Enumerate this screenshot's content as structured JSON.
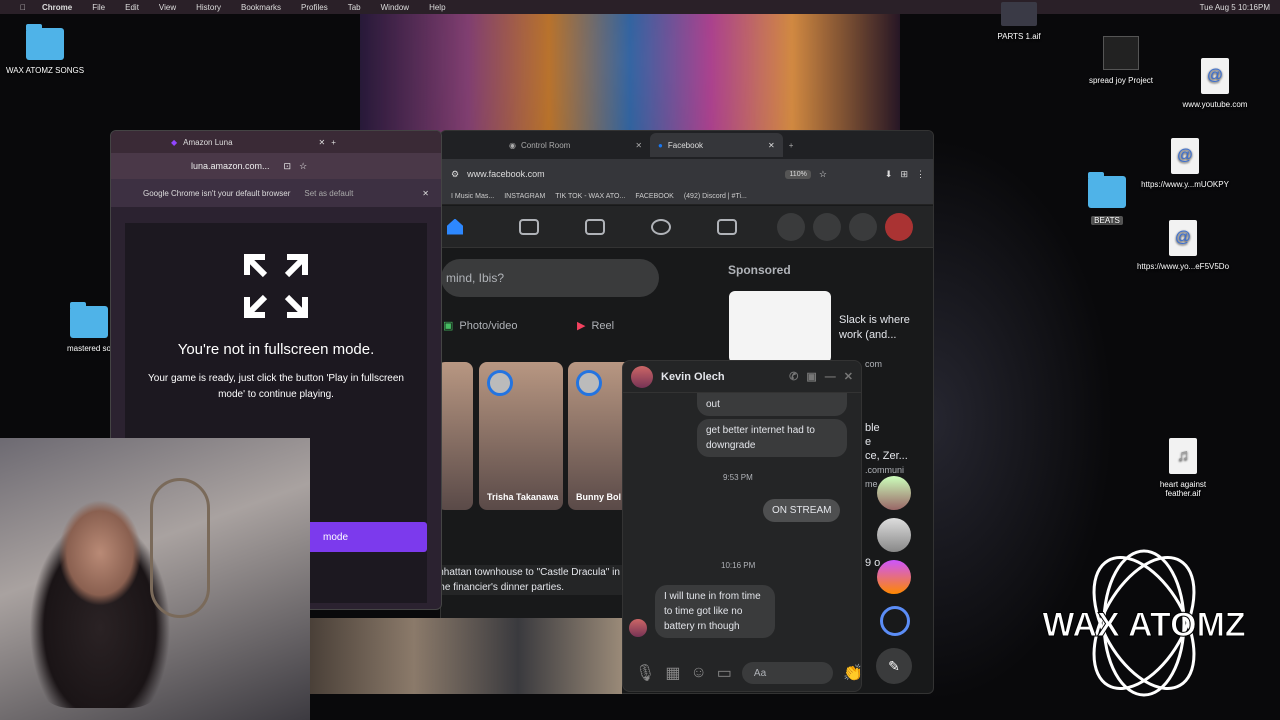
{
  "menubar": {
    "app": "Chrome",
    "items": [
      "File",
      "Edit",
      "View",
      "History",
      "Bookmarks",
      "Profiles",
      "Tab",
      "Window",
      "Help"
    ],
    "clock": "Tue Aug 5  10:16PM"
  },
  "desktop_icons": [
    {
      "label": "WAX ATOMZ SONGS",
      "type": "folder"
    },
    {
      "label": "mastered so",
      "type": "folder"
    },
    {
      "label": "PARTS 1.aif",
      "type": "file"
    },
    {
      "label": "spread joy Project",
      "type": "file"
    },
    {
      "label": "www.youtube.com",
      "type": "webloc"
    },
    {
      "label": "https://www.y...mUOKPY",
      "type": "webloc"
    },
    {
      "label": "BEATS",
      "type": "folder"
    },
    {
      "label": "https://www.yo...eF5V5Do",
      "type": "webloc"
    },
    {
      "label": "heart against feather.aif",
      "type": "audio"
    }
  ],
  "luna": {
    "tab_title": "Amazon Luna",
    "url": "luna.amazon.com...",
    "info_text": "Google Chrome isn't your default browser",
    "set_default": "Set as default",
    "title": "You're not in fullscreen mode.",
    "message": "Your game is ready, just click the button 'Play in fullscreen mode' to continue playing.",
    "button": "mode"
  },
  "fb": {
    "tabs": [
      "Control Room",
      "Facebook"
    ],
    "url": "www.facebook.com",
    "zoom": "110%",
    "bookmarks": [
      "I Music Mas...",
      "INSTAGRAM",
      "TIK TOK - WAX ATO...",
      "FACEBOOK",
      "(492) Discord | #Ti..."
    ],
    "compose_placeholder": "mind, Ibis?",
    "photo_label": "Photo/video",
    "reel_label": "Reel",
    "sponsored": "Sponsored",
    "ad_text": "Slack is where work (and...",
    "ad_domain": "com",
    "stories": [
      "Trisha Takanawa",
      "Bunny Bol"
    ],
    "news": "mpared Jeffrey Epstein's Manhattan townhouse to \"Castle Dracula\" in an undated birthday letter p the financier's dinner parties.",
    "right_col": [
      "ble",
      "e",
      "ce, Zer...",
      ".communi",
      "me",
      "9 o"
    ]
  },
  "messenger": {
    "name": "Kevin Olech",
    "msgs": [
      {
        "text": "out",
        "dir": "in"
      },
      {
        "text": "get better internet had to downgrade",
        "dir": "in"
      },
      {
        "time": "9:53 PM"
      },
      {
        "text": "ON STREAM",
        "dir": "out"
      },
      {
        "time": "10:16 PM"
      },
      {
        "text": "I will tune in from time to time got like no battery rn though",
        "dir": "in"
      }
    ],
    "input_placeholder": "Aa"
  },
  "brand": {
    "logo_text": "WAX ATOMZ"
  }
}
